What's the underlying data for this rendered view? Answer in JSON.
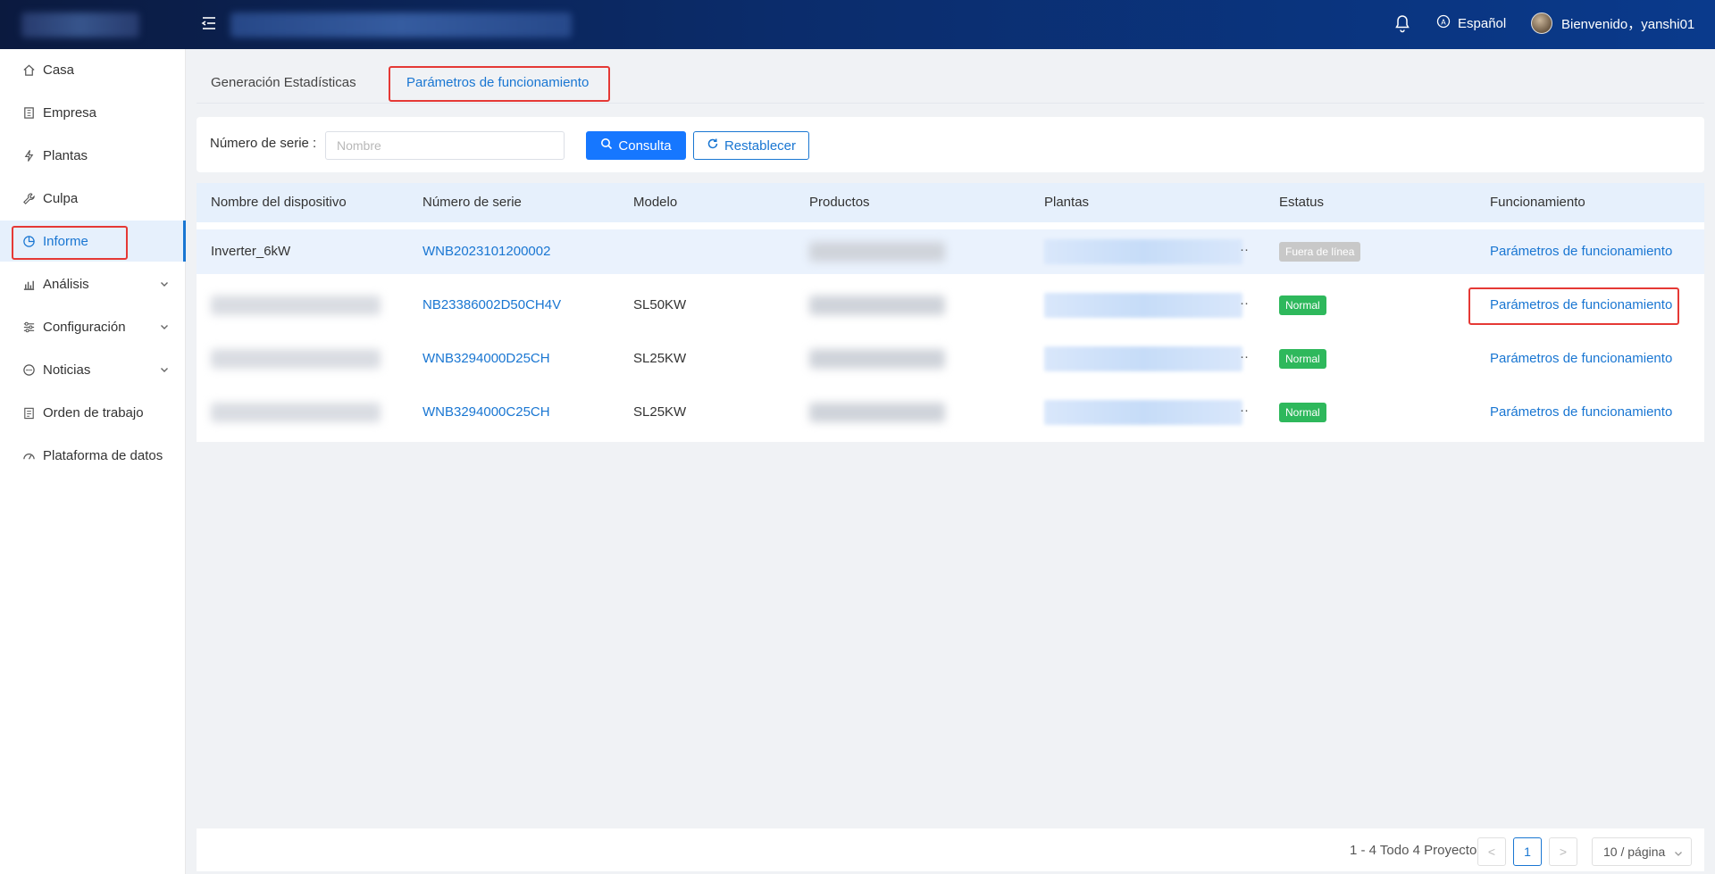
{
  "header": {
    "language": "Español",
    "welcome": "Bienvenido，yanshi01"
  },
  "sidebar": {
    "items": [
      {
        "label": "Casa",
        "icon": "home-icon"
      },
      {
        "label": "Empresa",
        "icon": "building-icon"
      },
      {
        "label": "Plantas",
        "icon": "lightning-icon"
      },
      {
        "label": "Culpa",
        "icon": "wrench-icon"
      },
      {
        "label": "Informe",
        "icon": "pie-chart-icon",
        "active": true
      },
      {
        "label": "Análisis",
        "icon": "bar-chart-icon",
        "expandable": true
      },
      {
        "label": "Configuración",
        "icon": "sliders-icon",
        "expandable": true
      },
      {
        "label": "Noticias",
        "icon": "message-icon",
        "expandable": true
      },
      {
        "label": "Orden de trabajo",
        "icon": "clipboard-icon"
      },
      {
        "label": "Plataforma de datos",
        "icon": "gauge-icon"
      }
    ]
  },
  "tabs": [
    {
      "label": "Generación Estadísticas",
      "active": false
    },
    {
      "label": "Parámetros de funcionamiento",
      "active": true
    }
  ],
  "filter": {
    "label": "Número de serie :",
    "placeholder": "Nombre",
    "value": "",
    "query_label": "Consulta",
    "reset_label": "Restablecer"
  },
  "table": {
    "columns": [
      "Nombre del dispositivo",
      "Número de serie",
      "Modelo",
      "Productos",
      "Plantas",
      "Estatus",
      "Funcionamiento"
    ],
    "rows": [
      {
        "name": "Inverter_6kW",
        "serial": "WNB2023101200002",
        "model": "",
        "status": "Fuera de línea",
        "status_type": "offline",
        "action": "Parámetros de funcionamiento"
      },
      {
        "name": "",
        "serial": "NB23386002D50CH4V",
        "model": "SL50KW",
        "status": "Normal",
        "status_type": "normal",
        "action": "Parámetros de funcionamiento"
      },
      {
        "name": "",
        "serial": "WNB3294000D25CH",
        "model": "SL25KW",
        "status": "Normal",
        "status_type": "normal",
        "action": "Parámetros de funcionamiento"
      },
      {
        "name": "",
        "serial": "WNB3294000C25CH",
        "model": "SL25KW",
        "status": "Normal",
        "status_type": "normal",
        "action": "Parámetros de funcionamiento"
      }
    ],
    "ellipsis": "··"
  },
  "pagination": {
    "summary": "1 - 4 Todo 4 Proyecto",
    "current_page": "1",
    "page_size": "10 / página",
    "prev": "<",
    "next": ">"
  },
  "colors": {
    "accent": "#1976d2",
    "primary_button": "#1677ff",
    "header_start": "#0b1a3f",
    "header_end": "#0a3a8c",
    "status_normal": "#2eb85c",
    "status_offline": "#c8c8c8",
    "highlight": "#e53935"
  }
}
